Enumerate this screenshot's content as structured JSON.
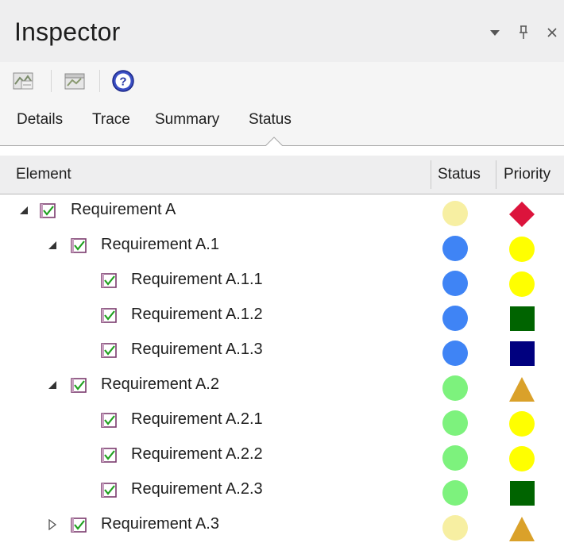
{
  "panel": {
    "title": "Inspector"
  },
  "window_buttons": {
    "dropdown": "▾",
    "pin": "⊥",
    "close": "✕"
  },
  "toolbar": {
    "buttons": [
      "select-elements-icon",
      "trace-diagram-icon",
      "help-icon"
    ]
  },
  "tabs": [
    {
      "label": "Details",
      "selected": false
    },
    {
      "label": "Trace",
      "selected": false
    },
    {
      "label": "Summary",
      "selected": false
    },
    {
      "label": "Status",
      "selected": true
    }
  ],
  "columns": {
    "element": "Element",
    "status": "Status",
    "priority": "Priority"
  },
  "colors": {
    "status_yellow": "#f7efa2",
    "status_blue": "#3f84f5",
    "status_green": "#7df27d",
    "priority_red": "#dc143c",
    "priority_yellow": "#ffff00",
    "priority_darkgreen": "#006400",
    "priority_navy": "#00007f",
    "priority_orange": "#daa12a"
  },
  "rows": [
    {
      "label": "Requirement A",
      "depth": 0,
      "expander": "expanded",
      "status": "yellow",
      "priority": {
        "shape": "diamond",
        "color": "red"
      }
    },
    {
      "label": "Requirement A.1",
      "depth": 1,
      "expander": "expanded",
      "status": "blue",
      "priority": {
        "shape": "circle",
        "color": "yellow"
      }
    },
    {
      "label": "Requirement A.1.1",
      "depth": 2,
      "expander": "none",
      "status": "blue",
      "priority": {
        "shape": "circle",
        "color": "yellow"
      }
    },
    {
      "label": "Requirement A.1.2",
      "depth": 2,
      "expander": "none",
      "status": "blue",
      "priority": {
        "shape": "square",
        "color": "darkgreen"
      }
    },
    {
      "label": "Requirement A.1.3",
      "depth": 2,
      "expander": "none",
      "status": "blue",
      "priority": {
        "shape": "square",
        "color": "navy"
      }
    },
    {
      "label": "Requirement A.2",
      "depth": 1,
      "expander": "expanded",
      "status": "green",
      "priority": {
        "shape": "triangle",
        "color": "orange"
      }
    },
    {
      "label": "Requirement A.2.1",
      "depth": 2,
      "expander": "none",
      "status": "green",
      "priority": {
        "shape": "circle",
        "color": "yellow"
      }
    },
    {
      "label": "Requirement A.2.2",
      "depth": 2,
      "expander": "none",
      "status": "green",
      "priority": {
        "shape": "circle",
        "color": "yellow"
      }
    },
    {
      "label": "Requirement A.2.3",
      "depth": 2,
      "expander": "none",
      "status": "green",
      "priority": {
        "shape": "square",
        "color": "darkgreen"
      }
    },
    {
      "label": "Requirement A.3",
      "depth": 1,
      "expander": "collapsed",
      "status": "yellow",
      "priority": {
        "shape": "triangle",
        "color": "orange"
      }
    }
  ]
}
